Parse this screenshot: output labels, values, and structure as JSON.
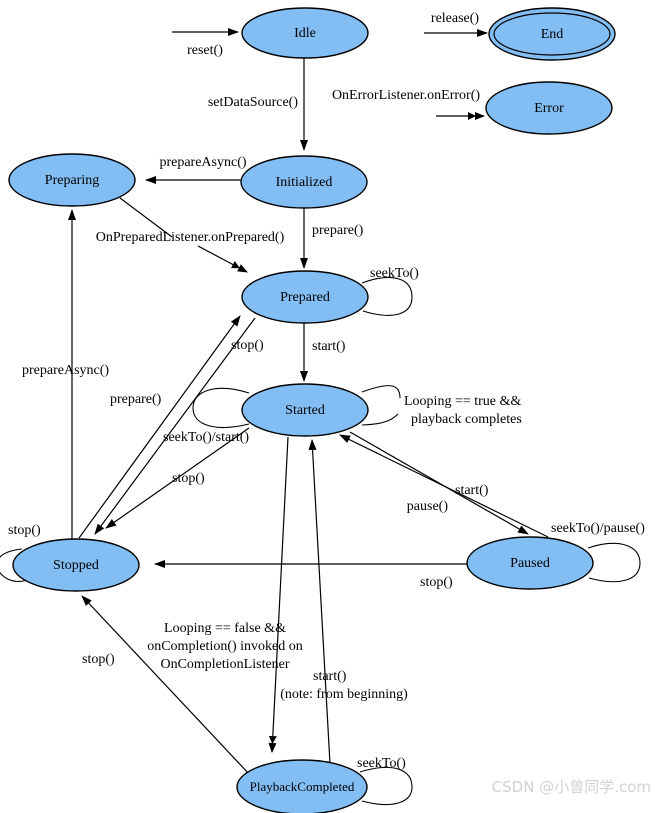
{
  "diagram": {
    "title": "MediaPlayer State Diagram",
    "type": "state-machine",
    "colors": {
      "state_fill": "#82bdf4",
      "state_stroke": "#000000",
      "edge": "#000000",
      "background": "#ffffff",
      "watermark": "#d2d2d2"
    },
    "states": [
      {
        "id": "idle",
        "label": "Idle",
        "final": false
      },
      {
        "id": "end",
        "label": "End",
        "final": true
      },
      {
        "id": "error",
        "label": "Error",
        "final": false
      },
      {
        "id": "preparing",
        "label": "Preparing",
        "final": false
      },
      {
        "id": "initialized",
        "label": "Initialized",
        "final": false
      },
      {
        "id": "prepared",
        "label": "Prepared",
        "final": false
      },
      {
        "id": "started",
        "label": "Started",
        "final": false
      },
      {
        "id": "stopped",
        "label": "Stopped",
        "final": false
      },
      {
        "id": "paused",
        "label": "Paused",
        "final": false
      },
      {
        "id": "playbackcompleted",
        "label": "PlaybackCompleted",
        "final": false
      }
    ],
    "transitions": [
      {
        "from": "",
        "to": "idle",
        "label": "reset()"
      },
      {
        "from": "",
        "to": "end",
        "label": "release()"
      },
      {
        "from": "idle",
        "to": "initialized",
        "label": "setDataSource()"
      },
      {
        "from": "",
        "to": "error",
        "label": "OnErrorListener.onError()"
      },
      {
        "from": "initialized",
        "to": "preparing",
        "label": "prepareAsync()"
      },
      {
        "from": "preparing",
        "to": "prepared",
        "label": "OnPreparedListener.onPrepared()"
      },
      {
        "from": "initialized",
        "to": "prepared",
        "label": "prepare()"
      },
      {
        "from": "prepared",
        "to": "prepared",
        "label": "seekTo()"
      },
      {
        "from": "prepared",
        "to": "started",
        "label": "start()"
      },
      {
        "from": "started",
        "to": "started",
        "label": "Looping == true &&"
      },
      {
        "from": "started",
        "to": "started",
        "label": "playback completes"
      },
      {
        "from": "started",
        "to": "started",
        "label": "seekTo()/start()"
      },
      {
        "from": "prepared",
        "to": "stopped",
        "label": "stop()"
      },
      {
        "from": "stopped",
        "to": "prepared",
        "label": "prepare()"
      },
      {
        "from": "stopped",
        "to": "preparing",
        "label": "prepareAsync()"
      },
      {
        "from": "started",
        "to": "stopped",
        "label": "stop()"
      },
      {
        "from": "started",
        "to": "paused",
        "label": "pause()"
      },
      {
        "from": "paused",
        "to": "started",
        "label": "start()"
      },
      {
        "from": "paused",
        "to": "paused",
        "label": "seekTo()/pause()"
      },
      {
        "from": "paused",
        "to": "stopped",
        "label": "stop()"
      },
      {
        "from": "stopped",
        "to": "stopped",
        "label": "stop()"
      },
      {
        "from": "started",
        "to": "playbackcompleted",
        "label": "Looping == false &&"
      },
      {
        "from": "started",
        "to": "playbackcompleted",
        "label": "onCompletion() invoked on"
      },
      {
        "from": "started",
        "to": "playbackcompleted",
        "label": "OnCompletionListener"
      },
      {
        "from": "playbackcompleted",
        "to": "started",
        "label": "start()"
      },
      {
        "from": "playbackcompleted",
        "to": "started",
        "label": "(note: from beginning)"
      },
      {
        "from": "playbackcompleted",
        "to": "stopped",
        "label": "stop()"
      },
      {
        "from": "playbackcompleted",
        "to": "playbackcompleted",
        "label": "seekTo()"
      }
    ],
    "labels": {
      "reset": "reset()",
      "release": "release()",
      "set_data_source": "setDataSource()",
      "on_error": "OnErrorListener.onError()",
      "prepare_async_top": "prepareAsync()",
      "on_prepared": "OnPreparedListener.onPrepared()",
      "prepare_right": "prepare()",
      "seek_to_prepared": "seekTo()",
      "start_prepared_started": "start()",
      "looping_true_1": "Looping == true &&",
      "looping_true_2": "playback completes",
      "stop_prepared_stopped": "stop()",
      "prepare_async_left": "prepareAsync()",
      "prepare_left": "prepare()",
      "seek_to_start": "seekTo()/start()",
      "stop_started_stopped": "stop()",
      "stop_self_stopped": "stop()",
      "pause": "pause()",
      "start_paused": "start()",
      "seek_to_pause": "seekTo()/pause()",
      "stop_paused_stopped": "stop()",
      "stop_pc_stopped": "stop()",
      "looping_false_1": "Looping == false &&",
      "looping_false_2": "onCompletion() invoked on",
      "looping_false_3": "OnCompletionListener",
      "start_pc": "start()",
      "note_from_beginning": "(note: from beginning)",
      "seek_to_pc": "seekTo()"
    },
    "state_labels": {
      "idle": "Idle",
      "end": "End",
      "error": "Error",
      "preparing": "Preparing",
      "initialized": "Initialized",
      "prepared": "Prepared",
      "started": "Started",
      "stopped": "Stopped",
      "paused": "Paused",
      "playbackcompleted": "PlaybackCompleted"
    }
  },
  "watermark": {
    "text": "CSDN @小曾同学.com"
  }
}
